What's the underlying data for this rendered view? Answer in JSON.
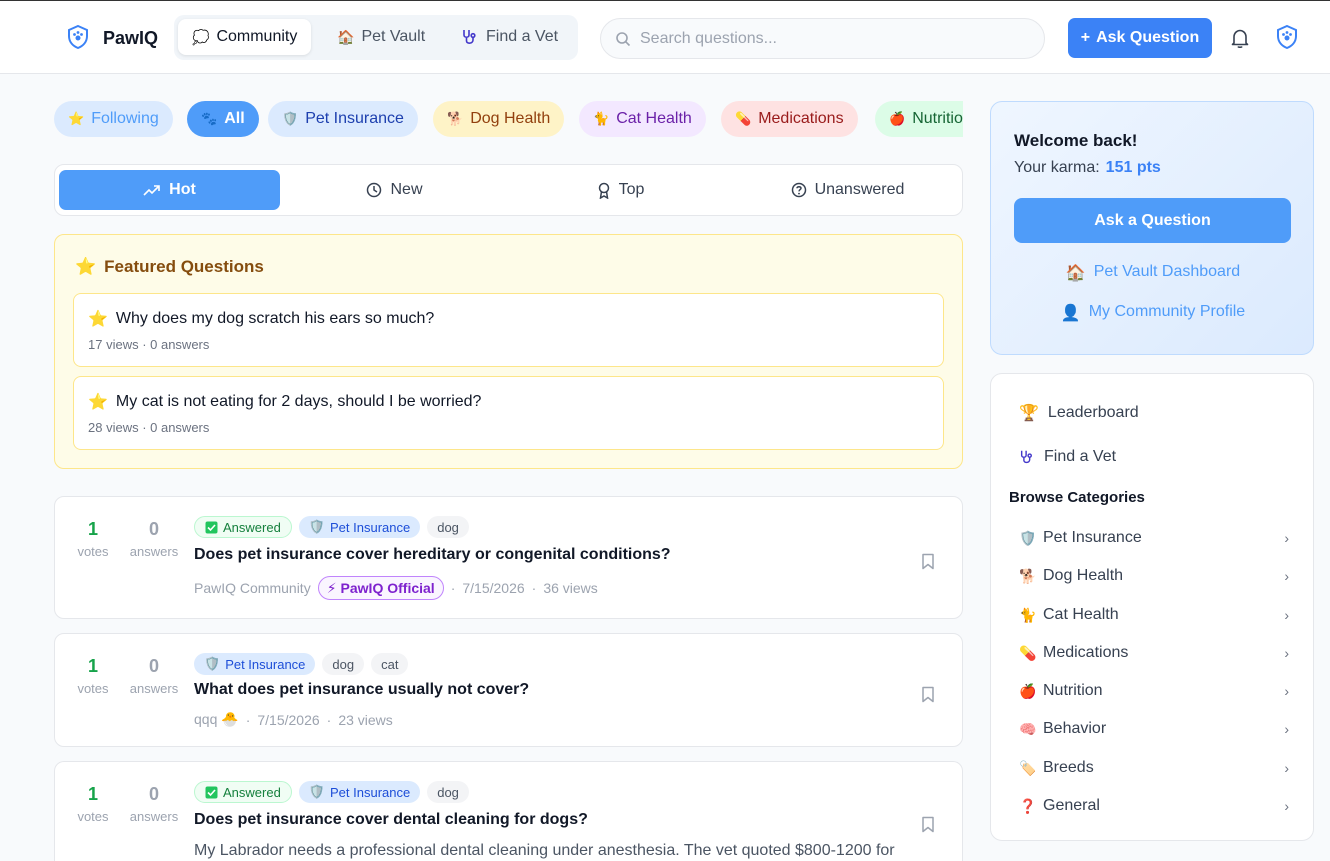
{
  "brand": {
    "name": "PawIQ"
  },
  "nav": {
    "tabs": [
      {
        "label": "Community",
        "emoji": "💭",
        "active": true
      },
      {
        "label": "Pet Vault",
        "emoji": "🏠",
        "active": false
      },
      {
        "label": "Find a Vet",
        "emoji": "🩺",
        "active": false
      }
    ]
  },
  "search": {
    "placeholder": "Search questions..."
  },
  "header": {
    "ask_label": "Ask Question",
    "ask_plus": "+"
  },
  "categories": [
    {
      "label": "Following",
      "emoji": "⭐"
    },
    {
      "label": "All",
      "emoji": "🐾",
      "active": true
    },
    {
      "label": "Pet Insurance",
      "emoji": "🛡️"
    },
    {
      "label": "Dog Health",
      "emoji": "🐕"
    },
    {
      "label": "Cat Health",
      "emoji": "🐈"
    },
    {
      "label": "Medications",
      "emoji": "💊"
    },
    {
      "label": "Nutrition",
      "emoji": "🍎"
    }
  ],
  "sort": {
    "tabs": [
      {
        "label": "Hot",
        "icon": "trending-up-icon",
        "active": true
      },
      {
        "label": "New",
        "icon": "clock-icon"
      },
      {
        "label": "Top",
        "icon": "award-icon"
      },
      {
        "label": "Unanswered",
        "icon": "help-circle-icon"
      }
    ]
  },
  "featured": {
    "title": "Featured Questions",
    "items": [
      {
        "question": "Why does my dog scratch his ears so much?",
        "meta": "17 views · 0 answers"
      },
      {
        "question": "My cat is not eating for 2 days, should I be worried?",
        "meta": "28 views · 0 answers"
      }
    ]
  },
  "questions": [
    {
      "votes": "1",
      "votes_label": "votes",
      "answers": "0",
      "answers_label": "answers",
      "answered_label": "Answered",
      "category": "Pet Insurance",
      "tags": [
        "dog"
      ],
      "title": "Does pet insurance cover hereditary or congenital conditions?",
      "author": "PawIQ Community",
      "badge": "PawIQ Official",
      "date": "7/15/2026",
      "views": "36 views"
    },
    {
      "votes": "1",
      "votes_label": "votes",
      "answers": "0",
      "answers_label": "answers",
      "category": "Pet Insurance",
      "tags": [
        "dog",
        "cat"
      ],
      "title": "What does pet insurance usually not cover?",
      "author": "qqq 🐣",
      "date": "7/15/2026",
      "views": "23 views"
    },
    {
      "votes": "1",
      "votes_label": "votes",
      "answers": "0",
      "answers_label": "answers",
      "answered_label": "Answered",
      "category": "Pet Insurance",
      "tags": [
        "dog"
      ],
      "title": "Does pet insurance cover dental cleaning for dogs?",
      "excerpt": "My Labrador needs a professional dental cleaning under anesthesia. The vet quoted $800-1200 for"
    }
  ],
  "welcome": {
    "title": "Welcome back!",
    "karma_label": "Your karma:",
    "karma_value": "151 pts",
    "ask_label": "Ask a Question",
    "links": [
      {
        "label": "Pet Vault Dashboard",
        "emoji": "🏠"
      },
      {
        "label": "My Community Profile",
        "emoji": "👤"
      }
    ]
  },
  "sidenav": {
    "links": [
      {
        "label": "Leaderboard",
        "emoji": "🏆"
      },
      {
        "label": "Find a Vet",
        "emoji": "🩺"
      }
    ],
    "browse_title": "Browse Categories",
    "categories": [
      {
        "label": "Pet Insurance",
        "emoji": "🛡️"
      },
      {
        "label": "Dog Health",
        "emoji": "🐕"
      },
      {
        "label": "Cat Health",
        "emoji": "🐈"
      },
      {
        "label": "Medications",
        "emoji": "💊"
      },
      {
        "label": "Nutrition",
        "emoji": "🍎"
      },
      {
        "label": "Behavior",
        "emoji": "🧠"
      },
      {
        "label": "Breeds",
        "emoji": "🏷️"
      },
      {
        "label": "General",
        "emoji": "❓"
      }
    ]
  },
  "colors": {
    "accent": "#3b82f6",
    "success": "#16a34a",
    "featured_bg": "#fefce8"
  }
}
